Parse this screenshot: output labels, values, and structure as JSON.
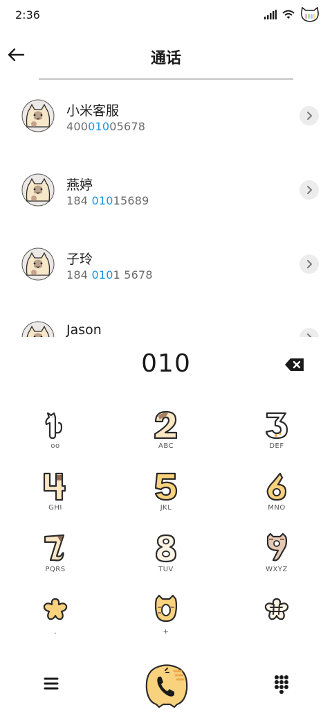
{
  "status_bar": {
    "time": "2:36",
    "icons": [
      "signal-icon",
      "wifi-icon",
      "cat-battery-icon"
    ]
  },
  "header": {
    "title": "通话",
    "back_icon": "back-arrow-icon"
  },
  "contacts": [
    {
      "name": "小米客服",
      "number_pre": "400",
      "number_match": "010",
      "number_post": "05678"
    },
    {
      "name": "燕婷",
      "number_pre": "184 ",
      "number_match": "010",
      "number_post": "15689"
    },
    {
      "name": "子玲",
      "number_pre": "184 ",
      "number_match": "010",
      "number_post": "1 5678"
    },
    {
      "name": "Jason",
      "number_pre": "",
      "number_match": "",
      "number_post": ""
    }
  ],
  "dialer": {
    "input_value": "010",
    "backspace_icon": "backspace-icon",
    "keys": [
      {
        "digit": "1",
        "sub": "oo"
      },
      {
        "digit": "2",
        "sub": "ABC"
      },
      {
        "digit": "3",
        "sub": "DEF"
      },
      {
        "digit": "4",
        "sub": "GHI"
      },
      {
        "digit": "5",
        "sub": "JKL"
      },
      {
        "digit": "6",
        "sub": "MNO"
      },
      {
        "digit": "7",
        "sub": "PQRS"
      },
      {
        "digit": "8",
        "sub": "TUV"
      },
      {
        "digit": "9",
        "sub": "WXYZ"
      },
      {
        "digit": "*",
        "sub": ","
      },
      {
        "digit": "0",
        "sub": "+"
      },
      {
        "digit": "#",
        "sub": ""
      }
    ]
  },
  "bottom_bar": {
    "menu_icon": "menu-icon",
    "call_icon": "cat-call-icon",
    "keypad_icon": "keypad-icon"
  },
  "colors": {
    "highlight": "#1e96e6",
    "cat_fill": "#f9d98f",
    "cat_outline": "#2a2a2a",
    "chevron_bg": "#ececec"
  }
}
